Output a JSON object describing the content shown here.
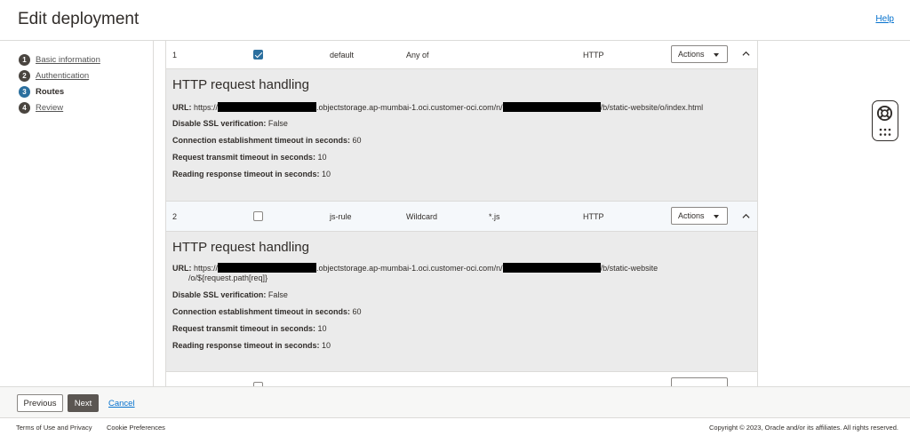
{
  "header": {
    "title": "Edit deployment",
    "help": "Help"
  },
  "steps": [
    {
      "num": "1",
      "label": "Basic information",
      "active": false
    },
    {
      "num": "2",
      "label": "Authentication",
      "active": false
    },
    {
      "num": "3",
      "label": "Routes",
      "active": true
    },
    {
      "num": "4",
      "label": "Review",
      "active": false
    }
  ],
  "routes": [
    {
      "index": "1",
      "checked": true,
      "path": "default",
      "method": "Any of",
      "match": "",
      "type": "HTTP",
      "actions_label": "Actions",
      "detail": {
        "heading": "HTTP request handling",
        "url_label": "URL:",
        "url_prefix": "https://",
        "url_mid": ".objectstorage.ap-mumbai-1.oci.customer-oci.com/n/",
        "url_suffix": "/b/static-website/o/index.html",
        "url_suffix2": "",
        "ssl_label": "Disable SSL verification:",
        "ssl_value": "False",
        "conn_label": "Connection establishment timeout in seconds:",
        "conn_value": "60",
        "req_label": "Request transmit timeout in seconds:",
        "req_value": "10",
        "read_label": "Reading response timeout in seconds:",
        "read_value": "10"
      }
    },
    {
      "index": "2",
      "checked": false,
      "path": "js-rule",
      "method": "Wildcard",
      "match": "*.js",
      "type": "HTTP",
      "actions_label": "Actions",
      "detail": {
        "heading": "HTTP request handling",
        "url_label": "URL:",
        "url_prefix": "https://",
        "url_mid": ".objectstorage.ap-mumbai-1.oci.customer-oci.com/n/",
        "url_suffix": "/b/static-website",
        "url_suffix2": "/o/${request.path[req]}",
        "ssl_label": "Disable SSL verification:",
        "ssl_value": "False",
        "conn_label": "Connection establishment timeout in seconds:",
        "conn_value": "60",
        "req_label": "Request transmit timeout in seconds:",
        "req_value": "10",
        "read_label": "Reading response timeout in seconds:",
        "read_value": "10"
      }
    }
  ],
  "buttons": {
    "previous": "Previous",
    "next": "Next",
    "cancel": "Cancel"
  },
  "footer": {
    "terms": "Terms of Use and Privacy",
    "cookies": "Cookie Preferences",
    "copyright": "Copyright © 2023, Oracle and/or its affiliates. All rights reserved."
  },
  "icons": {
    "help_widget": "lifebuoy-icon",
    "grid": "dots-grid-icon"
  },
  "colors": {
    "link": "#0572ce",
    "active_step": "#2b6f9e",
    "primary_button": "#5b5652"
  }
}
